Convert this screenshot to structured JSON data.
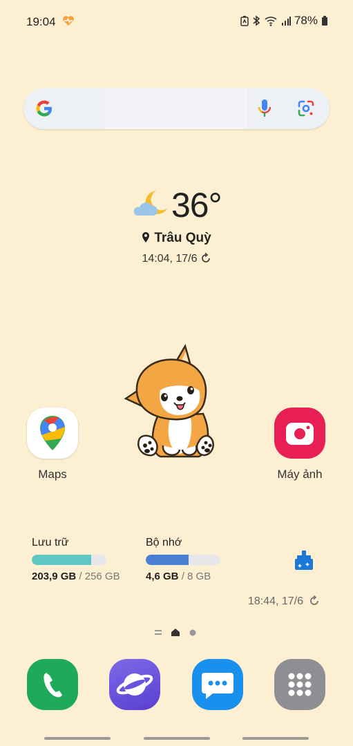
{
  "status_bar": {
    "time": "19:04",
    "battery": "78%"
  },
  "search": {
    "placeholder": ""
  },
  "weather": {
    "temperature": "36°",
    "location": "Trâu Quỳ",
    "updated": "14:04, 17/6"
  },
  "apps": {
    "maps": "Maps",
    "camera": "Máy ảnh"
  },
  "storage_widget": {
    "storage_title": "Lưu trữ",
    "storage_used": "203,9 GB",
    "storage_total": "/ 256 GB",
    "storage_fraction": 0.8,
    "memory_title": "Bộ nhớ",
    "memory_used": "4,6 GB",
    "memory_total": "/ 8 GB",
    "memory_fraction": 0.575,
    "updated": "18:44, 17/6"
  },
  "dock": [
    "phone-icon",
    "internet-icon",
    "messages-icon",
    "app-drawer-icon"
  ],
  "colors": {
    "wallpaper": "#fdf0d2",
    "storage_fill": "#5fc7c2",
    "memory_fill": "#4a7fd4",
    "camera": "#e81f55",
    "phone": "#1faa59",
    "messages": "#1a90ee"
  }
}
